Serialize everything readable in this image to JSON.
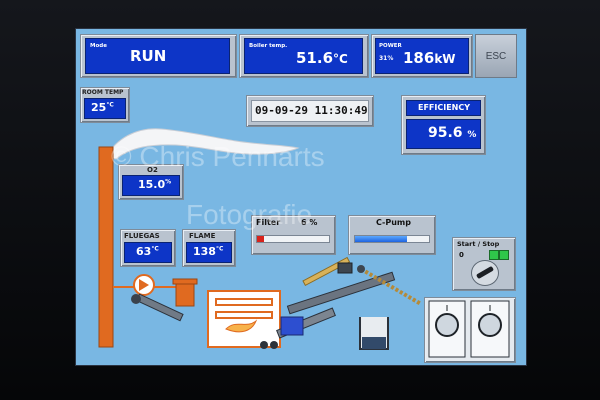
{
  "header": {
    "mode_label": "Mode",
    "mode_value": "RUN",
    "boiler_label": "Boiler temp.",
    "boiler_value": "51.6",
    "boiler_unit": "°C",
    "power_label": "POWER",
    "power_percent": "31%",
    "power_value": "186",
    "power_unit": "kW",
    "esc_label": "ESC"
  },
  "room_temp": {
    "label": "ROOM TEMP",
    "value": "25",
    "unit": "°C"
  },
  "datetime": "09-09-29 11:30:49",
  "efficiency": {
    "label": "EFFICIENCY",
    "value": "95.6",
    "unit": "%"
  },
  "o2": {
    "label": "O2",
    "value": "15.0",
    "unit": "%"
  },
  "fluegas": {
    "label": "FLUEGAS",
    "value": "63",
    "unit": "°C"
  },
  "flame": {
    "label": "FLAME",
    "value": "138",
    "unit": "°C"
  },
  "filter": {
    "label": "Filter",
    "value": "6",
    "unit": "%",
    "level": 0.06
  },
  "cpump": {
    "label": "C-Pump",
    "level": 0.7
  },
  "start_stop": {
    "label": "Start / Stop",
    "value": "0"
  },
  "watermark": {
    "line1": "© Chris Pennarts",
    "line2": "Fotografie"
  },
  "colors": {
    "screen_bg": "#79b7e3",
    "value_box": "#0d35c7",
    "chimney": "#e06a20",
    "pipe": "#e06a20"
  }
}
